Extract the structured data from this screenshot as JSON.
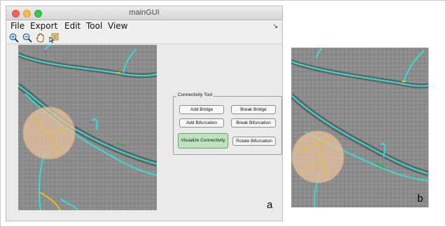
{
  "window": {
    "title": "mainGUI"
  },
  "menu": {
    "items": [
      "File",
      "Export",
      "Edit",
      "Tool",
      "View"
    ],
    "overflow_arrow": "↘"
  },
  "toolbar": {
    "icons": [
      "zoom-in-icon",
      "zoom-out-icon",
      "pan-hand-icon",
      "data-cursor-icon"
    ]
  },
  "connectivity_tool": {
    "title": "Connectivity Tool",
    "buttons": {
      "add_bridge": "Add Bridge",
      "break_bridge": "Break Bridge",
      "add_bifurcation": "Add Bifurcation",
      "break_bifurcation": "Break Bifurcation",
      "visualize_connectivity": "Visualize Connectivity",
      "rotate_bifurcation": "Rotate Bifurcation"
    },
    "active_button_color": "#bfe3bf"
  },
  "panels": {
    "a_label": "a",
    "b_label": "b"
  },
  "colors": {
    "vessel": "#2fe0d6",
    "bifurcation": "#e8c020",
    "bridge_marker": "#3aa83a",
    "endpoint": "#c040e0",
    "selection_circle": "#e8c3a0"
  }
}
